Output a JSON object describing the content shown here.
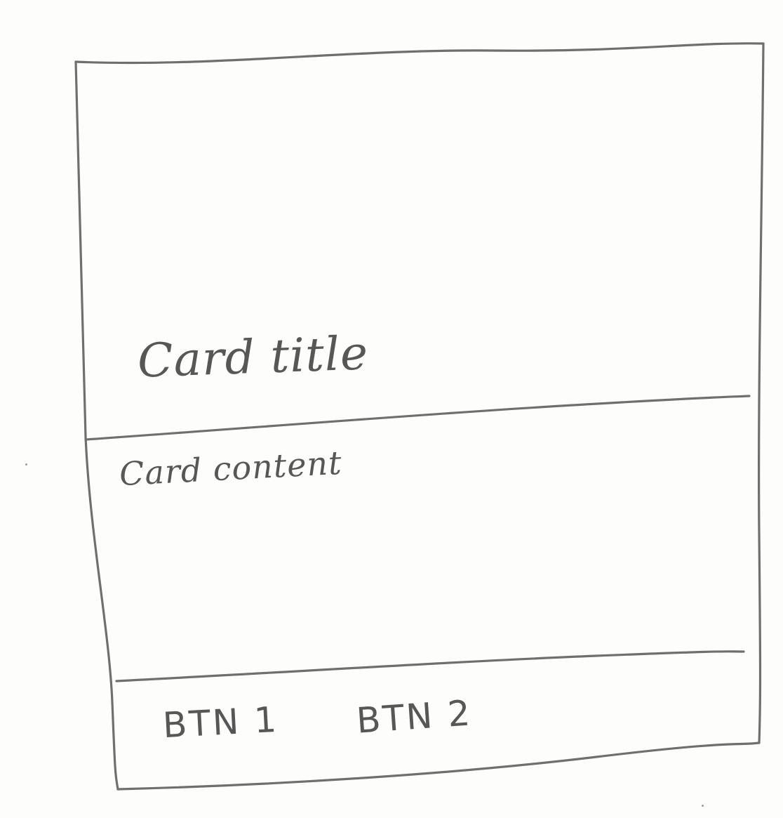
{
  "card": {
    "title": "Card title",
    "content": "Card content",
    "actions": [
      {
        "label": "BTN 1"
      },
      {
        "label": "BTN 2"
      }
    ]
  },
  "colors": {
    "paper": "#fdfdfb",
    "pencil": "#6f6f6f",
    "ink": "#575757"
  }
}
